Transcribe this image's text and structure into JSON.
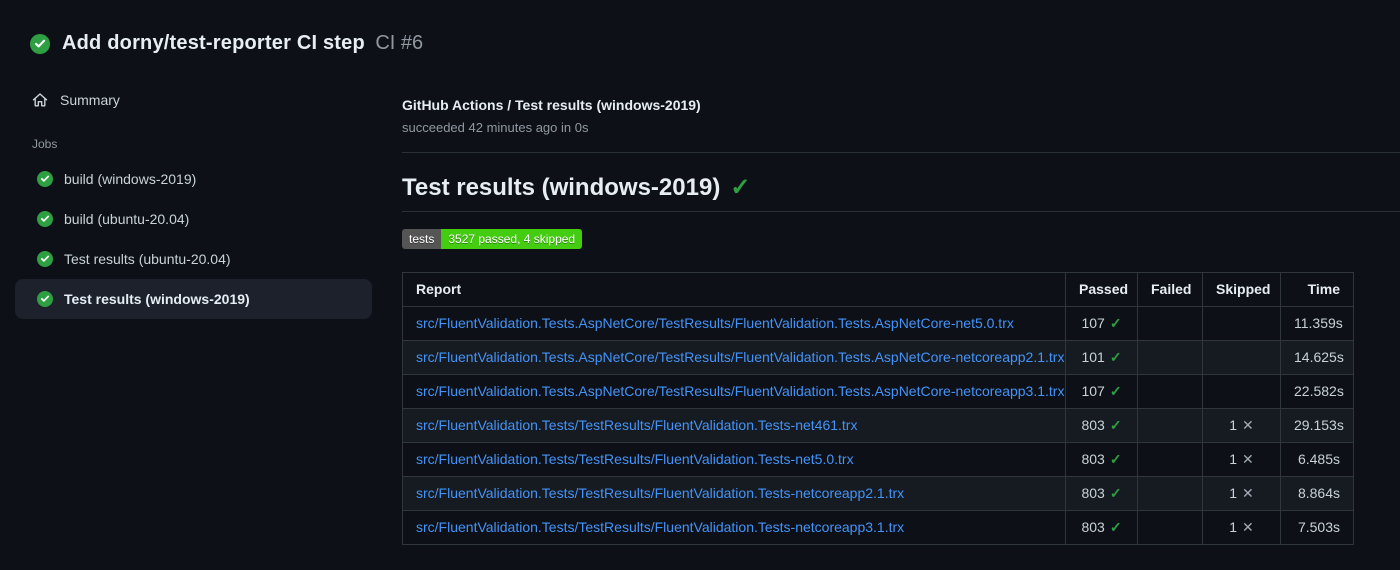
{
  "header": {
    "title": "Add dorny/test-reporter CI step",
    "run_number": "CI #6",
    "status": "success"
  },
  "sidebar": {
    "summary_label": "Summary",
    "jobs_label": "Jobs",
    "jobs": [
      {
        "label": "build (windows-2019)",
        "status": "success",
        "selected": false
      },
      {
        "label": "build (ubuntu-20.04)",
        "status": "success",
        "selected": false
      },
      {
        "label": "Test results (ubuntu-20.04)",
        "status": "success",
        "selected": false
      },
      {
        "label": "Test results (windows-2019)",
        "status": "success",
        "selected": true
      }
    ]
  },
  "main": {
    "check_name": "GitHub Actions / Test results (windows-2019)",
    "check_status": "succeeded 42 minutes ago in 0s",
    "section_title": "Test results (windows-2019)",
    "badge": {
      "label": "tests",
      "value": "3527 passed, 4 skipped",
      "label_bg": "#555555",
      "value_bg": "#44cc11"
    },
    "table": {
      "columns": [
        "Report",
        "Passed",
        "Failed",
        "Skipped",
        "Time"
      ],
      "rows": [
        {
          "report": "src/FluentValidation.Tests.AspNetCore/TestResults/FluentValidation.Tests.AspNetCore-net5.0.trx",
          "passed": "107",
          "failed": "",
          "skipped": "",
          "time": "11.359s"
        },
        {
          "report": "src/FluentValidation.Tests.AspNetCore/TestResults/FluentValidation.Tests.AspNetCore-netcoreapp2.1.trx",
          "passed": "101",
          "failed": "",
          "skipped": "",
          "time": "14.625s"
        },
        {
          "report": "src/FluentValidation.Tests.AspNetCore/TestResults/FluentValidation.Tests.AspNetCore-netcoreapp3.1.trx",
          "passed": "107",
          "failed": "",
          "skipped": "",
          "time": "22.582s"
        },
        {
          "report": "src/FluentValidation.Tests/TestResults/FluentValidation.Tests-net461.trx",
          "passed": "803",
          "failed": "",
          "skipped": "1",
          "time": "29.153s"
        },
        {
          "report": "src/FluentValidation.Tests/TestResults/FluentValidation.Tests-net5.0.trx",
          "passed": "803",
          "failed": "",
          "skipped": "1",
          "time": "6.485s"
        },
        {
          "report": "src/FluentValidation.Tests/TestResults/FluentValidation.Tests-netcoreapp2.1.trx",
          "passed": "803",
          "failed": "",
          "skipped": "1",
          "time": "8.864s"
        },
        {
          "report": "src/FluentValidation.Tests/TestResults/FluentValidation.Tests-netcoreapp3.1.trx",
          "passed": "803",
          "failed": "",
          "skipped": "1",
          "time": "7.503s"
        }
      ]
    }
  },
  "icons": {
    "check_glyph": "✓",
    "cross_glyph": "✕"
  },
  "colors": {
    "background": "#0d1117",
    "accent_green": "#2ea043",
    "link_blue": "#4493f8",
    "table_border": "#30363d",
    "alt_row": "#161b22"
  }
}
